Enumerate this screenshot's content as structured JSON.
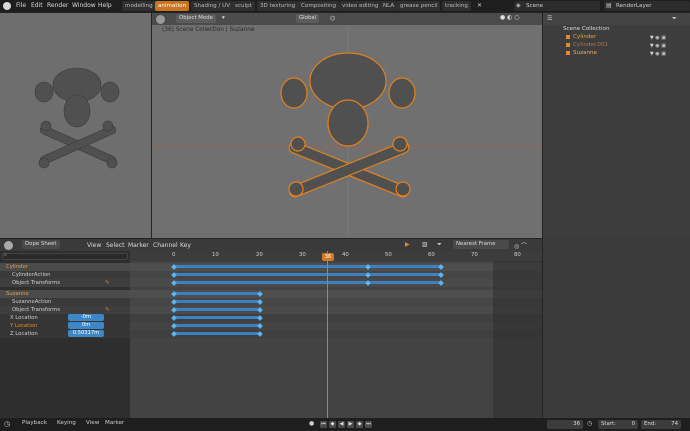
{
  "topbar": {
    "menus": [
      "File",
      "Edit",
      "Render",
      "Window",
      "Help"
    ],
    "workspaces": [
      "modelling",
      "animation",
      "Shading / UV",
      "sculpt",
      "3D texturing",
      "Compositing",
      "video editing",
      "NLA",
      "grease pencil",
      "tracking"
    ],
    "active_workspace": "animation",
    "scene": "Scene",
    "render_layer": "RenderLayer"
  },
  "viewport": {
    "mode": "Object Mode",
    "orientation": "Global",
    "label": "(36) Scene Collection | Suzanne"
  },
  "outliner": {
    "root": "Scene Collection",
    "items": [
      {
        "name": "Cylinder",
        "state": "selected"
      },
      {
        "name": "Cylinder.001",
        "state": "dim"
      },
      {
        "name": "Suzanne",
        "state": "active"
      }
    ]
  },
  "dopesheet": {
    "editor_type": "Dope Sheet",
    "menus": [
      "View",
      "Select",
      "Marker",
      "Channel",
      "Key"
    ],
    "snap": "Nearest Frame",
    "current_frame": "36",
    "ruler_ticks": [
      "0",
      "10",
      "20",
      "30",
      "40",
      "50",
      "60",
      "70",
      "80"
    ],
    "channels": [
      {
        "name": "Cylinder",
        "type": "obj"
      },
      {
        "name": "CylinderAction",
        "type": "act"
      },
      {
        "name": "Object Transforms",
        "type": "grp"
      },
      {
        "name": "Suzanne",
        "type": "obj"
      },
      {
        "name": "SuzanneAction",
        "type": "act"
      },
      {
        "name": "Object Transforms",
        "type": "grp"
      },
      {
        "name": "X Location",
        "type": "ch",
        "value": "-0m"
      },
      {
        "name": "Y Location",
        "type": "ch",
        "value": "0m"
      },
      {
        "name": "Z Location",
        "type": "ch",
        "value": "0.50317m"
      }
    ]
  },
  "footer": {
    "menus": [
      "Playback",
      "Keying",
      "View",
      "Marker"
    ],
    "frame": "36",
    "start_label": "Start:",
    "start": "0",
    "end_label": "End:",
    "end": "74"
  },
  "colors": {
    "accent": "#d07a24",
    "keyframe": "#58b6f3",
    "keyframe_bar": "#3e7fbd"
  }
}
